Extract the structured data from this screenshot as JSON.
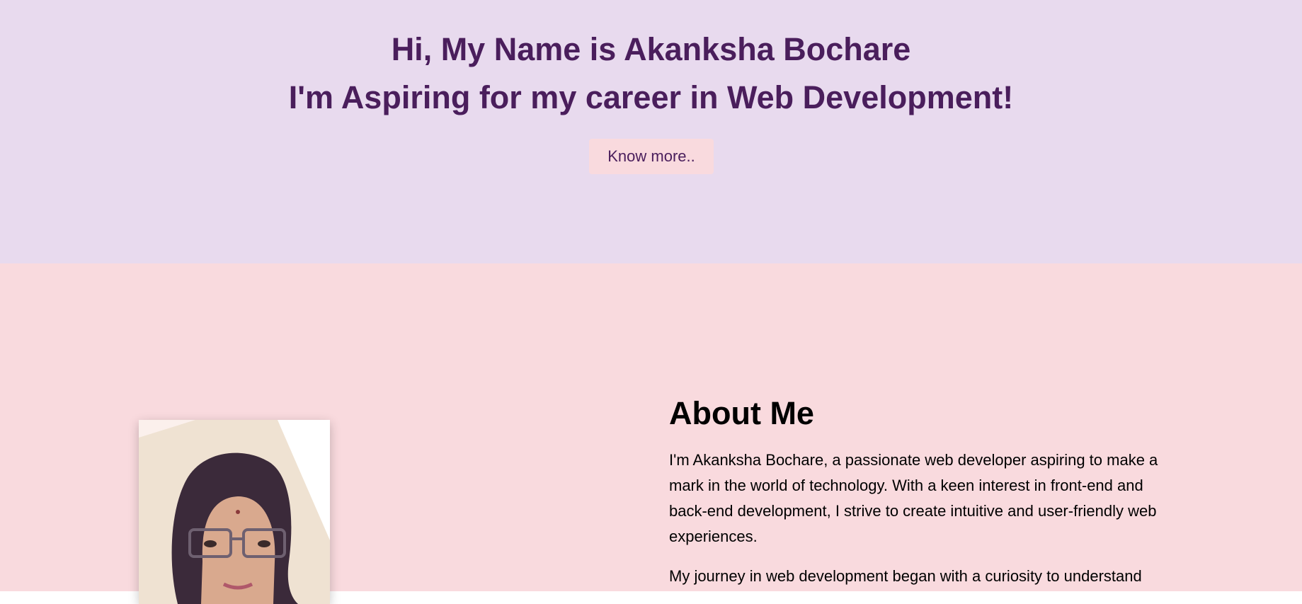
{
  "hero": {
    "greeting": "Hi, My Name is Akanksha Bochare",
    "tagline": "I'm Aspiring for my career in Web Development!",
    "button_label": "Know more.."
  },
  "about": {
    "heading": "About Me",
    "paragraphs": [
      "I'm Akanksha Bochare, a passionate web developer aspiring to make a mark in the world of technology. With a keen interest in front-end and back-end development, I strive to create intuitive and user-friendly web experiences.",
      "My journey in web development began with a curiosity to understand"
    ]
  },
  "colors": {
    "hero_bg": "#e8daee",
    "about_bg": "#f9dade",
    "accent_text": "#4a1e5c",
    "button_bg": "#f9dade"
  }
}
